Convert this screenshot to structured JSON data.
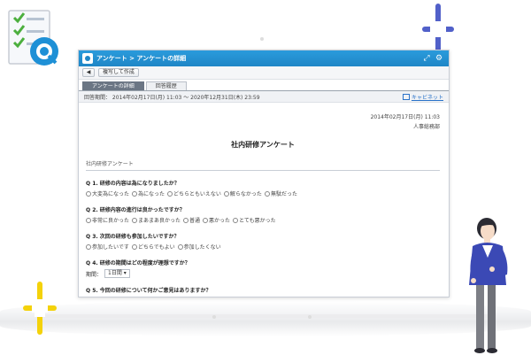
{
  "window": {
    "breadcrumb": "アンケート > アンケートの詳細"
  },
  "toolbar": {
    "back_label": "◀",
    "copy_label": "複写して作成"
  },
  "tabs": [
    {
      "label": "アンケートの詳細",
      "active": true
    },
    {
      "label": "回答履歴",
      "active": false
    }
  ],
  "period": {
    "text": "回答期間： 2014年02月17日(月) 11:03 ～ 2020年12月31日(木) 23:59",
    "cabinet_link": "キャビネット"
  },
  "survey": {
    "date": "2014年02月17日(月) 11:03",
    "department": "人事総務部",
    "title": "社内研修アンケート",
    "section_label": "社内研修アンケート"
  },
  "questions": [
    {
      "text": "Q 1. 研修の内容は為になりましたか？",
      "options": [
        "大変為になった",
        "為になった",
        "どちらともいえない",
        "解らなかった",
        "無駄だった"
      ]
    },
    {
      "text": "Q 2. 研修内容の進行は良かったですか？",
      "options": [
        "非常に良かった",
        "まあまあ良かった",
        "普通",
        "悪かった",
        "とても悪かった"
      ]
    },
    {
      "text": "Q 3. 次回の研修も参加したいですか？",
      "options": [
        "参加したいです",
        "どちらでもよい",
        "参加したくない"
      ]
    },
    {
      "text": "Q 4. 研修の期間はどの程度が理想ですか？",
      "period_label": "期間：",
      "select_value": "1日間 ▾"
    },
    {
      "text": "Q 5. 今回の研修について何かご意見はありますか？"
    }
  ],
  "colors": {
    "titlebar": "#1f86c6",
    "active_tab": "#6b7684",
    "sparkle_blue": "#5160c9",
    "sparkle_yellow": "#f4d20a"
  },
  "icons": [
    "survey-app-icon",
    "back-arrow-icon",
    "cabinet-icon",
    "expand-icon",
    "gear-icon"
  ]
}
